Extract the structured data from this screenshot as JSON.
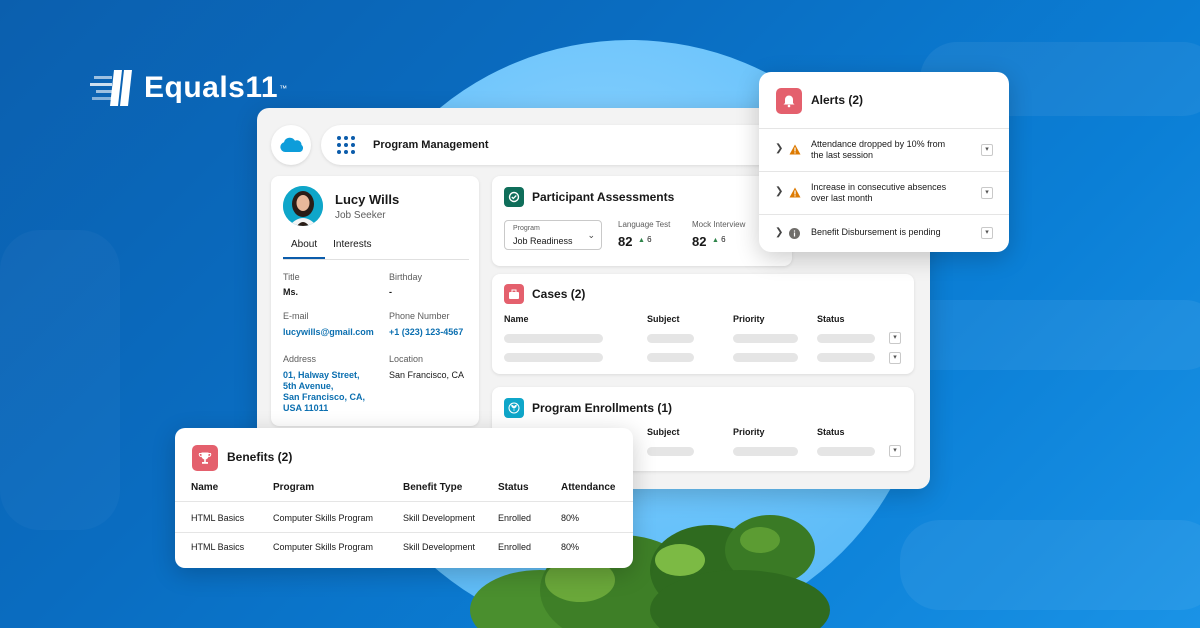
{
  "brand": {
    "name": "Equals11",
    "trademark": "™"
  },
  "app": {
    "title": "Program Management"
  },
  "profile": {
    "name": "Lucy Wills",
    "role": "Job Seeker",
    "tabs": [
      "About",
      "Interests"
    ],
    "fields": {
      "title_label": "Title",
      "title_value": "Ms.",
      "birthday_label": "Birthday",
      "birthday_value": "-",
      "email_label": "E-mail",
      "email_value": "lucywills@gmail.com",
      "phone_label": "Phone Number",
      "phone_value": "+1 (323) 123-4567",
      "address_label": "Address",
      "address_lines": [
        "01, Halway Street,",
        "5th Avenue,",
        "San Francisco, CA,",
        "USA 11011"
      ],
      "location_label": "Location",
      "location_value": "San Francisco, CA"
    }
  },
  "assessments": {
    "title": "Participant Assessments",
    "program_label": "Program",
    "program_value": "Job Readiness",
    "metrics": [
      {
        "label": "Language Test",
        "value": "82",
        "delta": "6"
      },
      {
        "label": "Mock Interview",
        "value": "82",
        "delta": "6"
      }
    ]
  },
  "cases": {
    "title": "Cases (2)",
    "columns": [
      "Name",
      "Subject",
      "Priority",
      "Status"
    ]
  },
  "enrollments": {
    "title": "Program Enrollments (1)",
    "columns": [
      "Subject",
      "Priority",
      "Status"
    ]
  },
  "alerts": {
    "title": "Alerts (2)",
    "items": [
      {
        "text_lines": [
          "Attendance dropped by 10% from",
          "the last session"
        ],
        "icon": "warning-icon"
      },
      {
        "text_lines": [
          "Increase in consecutive absences",
          "over last month"
        ],
        "icon": "warning-icon"
      },
      {
        "text_lines": [
          "Benefit Disbursement is pending"
        ],
        "icon": "info-icon"
      }
    ]
  },
  "benefits": {
    "title": "Benefits (2)",
    "columns": [
      "Name",
      "Program",
      "Benefit Type",
      "Status",
      "Attendance"
    ],
    "rows": [
      [
        "HTML Basics",
        "Computer Skills Program",
        "Skill Development",
        "Enrolled",
        "80%"
      ],
      [
        "HTML Basics",
        "Computer Skills Program",
        "Skill Development",
        "Enrolled",
        "80%"
      ]
    ]
  },
  "colors": {
    "accent": "#0b5cab",
    "alert_red": "#e4606d",
    "assess_green": "#0f6e5a",
    "teal": "#0fa6c9",
    "warning_orange": "#dd7a01"
  }
}
